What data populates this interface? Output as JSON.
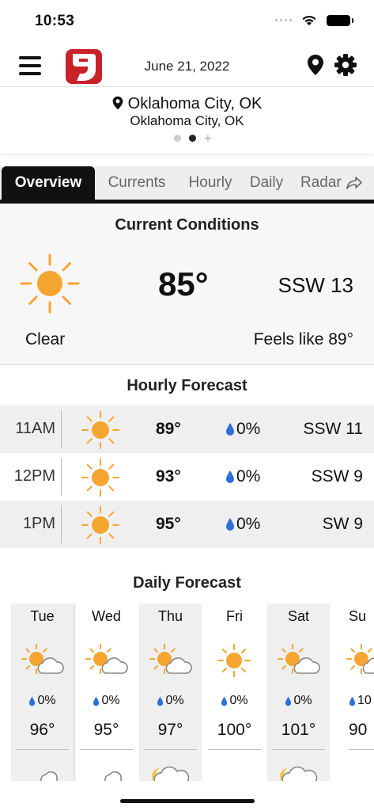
{
  "status": {
    "time": "10:53"
  },
  "header": {
    "date": "June 21, 2022"
  },
  "location": {
    "name": "Oklahoma City, OK",
    "subtitle": "Oklahoma City, OK"
  },
  "tabs": [
    {
      "label": "Overview",
      "active": true
    },
    {
      "label": "Currents"
    },
    {
      "label": "Hourly"
    },
    {
      "label": "Daily"
    },
    {
      "label": "Radar"
    }
  ],
  "current": {
    "title": "Current Conditions",
    "temp": "85°",
    "wind": "SSW 13",
    "condition": "Clear",
    "feels_like": "Feels like 89°",
    "icon": "sun-icon"
  },
  "hourly": {
    "title": "Hourly Forecast",
    "rows": [
      {
        "time": "11AM",
        "temp": "89°",
        "precip": "0%",
        "wind": "SSW 11",
        "icon": "sun-icon"
      },
      {
        "time": "12PM",
        "temp": "93°",
        "precip": "0%",
        "wind": "SSW 9",
        "icon": "sun-icon"
      },
      {
        "time": "1PM",
        "temp": "95°",
        "precip": "0%",
        "wind": "SW 9",
        "icon": "sun-icon"
      }
    ]
  },
  "daily": {
    "title": "Daily Forecast",
    "days": [
      {
        "name": "Tue",
        "precip": "0%",
        "temp": "96°",
        "icon": "partly-cloudy-icon",
        "night_icon": "moon-cloud-icon"
      },
      {
        "name": "Wed",
        "precip": "0%",
        "temp": "95°",
        "icon": "partly-cloudy-icon",
        "night_icon": "moon-cloud-icon"
      },
      {
        "name": "Thu",
        "precip": "0%",
        "temp": "97°",
        "icon": "partly-cloudy-icon",
        "night_icon": "cloudy-icon"
      },
      {
        "name": "Fri",
        "precip": "0%",
        "temp": "100°",
        "icon": "sun-icon",
        "night_icon": "moon-icon"
      },
      {
        "name": "Sat",
        "precip": "0%",
        "temp": "101°",
        "icon": "partly-cloudy-icon",
        "night_icon": "cloudy-icon"
      },
      {
        "name": "Su",
        "precip": "10",
        "temp": "90",
        "icon": "partly-cloudy-icon",
        "night_icon": "moon-icon"
      }
    ]
  },
  "colors": {
    "sun": "#f7a531",
    "precip": "#2f6fd8",
    "logo": "#c8222a"
  }
}
